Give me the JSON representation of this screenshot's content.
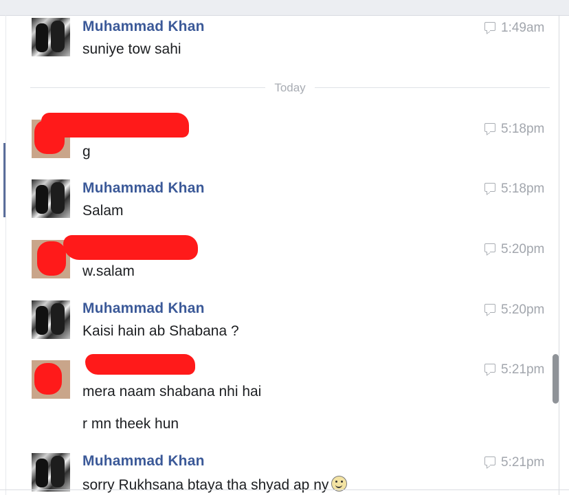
{
  "divider": {
    "label": "Today"
  },
  "messages": [
    {
      "sender": "Muhammad Khan",
      "lines": [
        "suniye tow sahi"
      ],
      "time": "1:49am"
    },
    {
      "sender": "",
      "lines": [
        "g"
      ],
      "time": "5:18pm"
    },
    {
      "sender": "Muhammad Khan",
      "lines": [
        "Salam"
      ],
      "time": "5:18pm"
    },
    {
      "sender": "",
      "lines": [
        "w.salam"
      ],
      "time": "5:20pm"
    },
    {
      "sender": "Muhammad Khan",
      "lines": [
        "Kaisi hain ab Shabana ?"
      ],
      "time": "5:20pm"
    },
    {
      "sender": "",
      "lines": [
        "mera naam shabana nhi hai",
        "r mn theek hun"
      ],
      "time": "5:21pm"
    },
    {
      "sender": "Muhammad Khan",
      "lines": [
        "sorry Rukhsana btaya tha shyad ap ny"
      ],
      "time": "5:21pm",
      "icon": "smiley-emoji-icon"
    }
  ]
}
